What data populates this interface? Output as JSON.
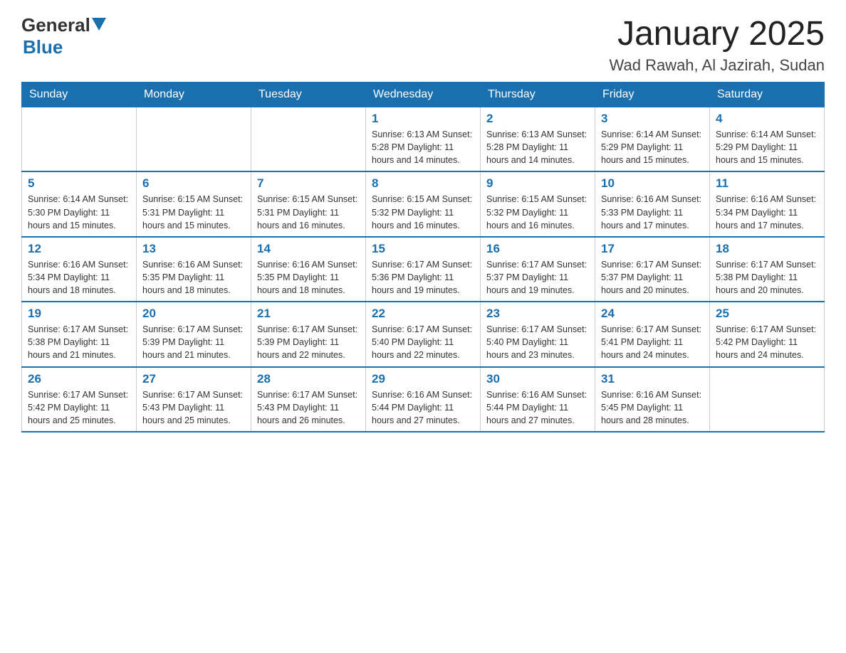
{
  "header": {
    "title": "January 2025",
    "subtitle": "Wad Rawah, Al Jazirah, Sudan"
  },
  "logo": {
    "general": "General",
    "blue": "Blue"
  },
  "days": [
    "Sunday",
    "Monday",
    "Tuesday",
    "Wednesday",
    "Thursday",
    "Friday",
    "Saturday"
  ],
  "weeks": [
    [
      {
        "day": "",
        "info": ""
      },
      {
        "day": "",
        "info": ""
      },
      {
        "day": "",
        "info": ""
      },
      {
        "day": "1",
        "info": "Sunrise: 6:13 AM\nSunset: 5:28 PM\nDaylight: 11 hours\nand 14 minutes."
      },
      {
        "day": "2",
        "info": "Sunrise: 6:13 AM\nSunset: 5:28 PM\nDaylight: 11 hours\nand 14 minutes."
      },
      {
        "day": "3",
        "info": "Sunrise: 6:14 AM\nSunset: 5:29 PM\nDaylight: 11 hours\nand 15 minutes."
      },
      {
        "day": "4",
        "info": "Sunrise: 6:14 AM\nSunset: 5:29 PM\nDaylight: 11 hours\nand 15 minutes."
      }
    ],
    [
      {
        "day": "5",
        "info": "Sunrise: 6:14 AM\nSunset: 5:30 PM\nDaylight: 11 hours\nand 15 minutes."
      },
      {
        "day": "6",
        "info": "Sunrise: 6:15 AM\nSunset: 5:31 PM\nDaylight: 11 hours\nand 15 minutes."
      },
      {
        "day": "7",
        "info": "Sunrise: 6:15 AM\nSunset: 5:31 PM\nDaylight: 11 hours\nand 16 minutes."
      },
      {
        "day": "8",
        "info": "Sunrise: 6:15 AM\nSunset: 5:32 PM\nDaylight: 11 hours\nand 16 minutes."
      },
      {
        "day": "9",
        "info": "Sunrise: 6:15 AM\nSunset: 5:32 PM\nDaylight: 11 hours\nand 16 minutes."
      },
      {
        "day": "10",
        "info": "Sunrise: 6:16 AM\nSunset: 5:33 PM\nDaylight: 11 hours\nand 17 minutes."
      },
      {
        "day": "11",
        "info": "Sunrise: 6:16 AM\nSunset: 5:34 PM\nDaylight: 11 hours\nand 17 minutes."
      }
    ],
    [
      {
        "day": "12",
        "info": "Sunrise: 6:16 AM\nSunset: 5:34 PM\nDaylight: 11 hours\nand 18 minutes."
      },
      {
        "day": "13",
        "info": "Sunrise: 6:16 AM\nSunset: 5:35 PM\nDaylight: 11 hours\nand 18 minutes."
      },
      {
        "day": "14",
        "info": "Sunrise: 6:16 AM\nSunset: 5:35 PM\nDaylight: 11 hours\nand 18 minutes."
      },
      {
        "day": "15",
        "info": "Sunrise: 6:17 AM\nSunset: 5:36 PM\nDaylight: 11 hours\nand 19 minutes."
      },
      {
        "day": "16",
        "info": "Sunrise: 6:17 AM\nSunset: 5:37 PM\nDaylight: 11 hours\nand 19 minutes."
      },
      {
        "day": "17",
        "info": "Sunrise: 6:17 AM\nSunset: 5:37 PM\nDaylight: 11 hours\nand 20 minutes."
      },
      {
        "day": "18",
        "info": "Sunrise: 6:17 AM\nSunset: 5:38 PM\nDaylight: 11 hours\nand 20 minutes."
      }
    ],
    [
      {
        "day": "19",
        "info": "Sunrise: 6:17 AM\nSunset: 5:38 PM\nDaylight: 11 hours\nand 21 minutes."
      },
      {
        "day": "20",
        "info": "Sunrise: 6:17 AM\nSunset: 5:39 PM\nDaylight: 11 hours\nand 21 minutes."
      },
      {
        "day": "21",
        "info": "Sunrise: 6:17 AM\nSunset: 5:39 PM\nDaylight: 11 hours\nand 22 minutes."
      },
      {
        "day": "22",
        "info": "Sunrise: 6:17 AM\nSunset: 5:40 PM\nDaylight: 11 hours\nand 22 minutes."
      },
      {
        "day": "23",
        "info": "Sunrise: 6:17 AM\nSunset: 5:40 PM\nDaylight: 11 hours\nand 23 minutes."
      },
      {
        "day": "24",
        "info": "Sunrise: 6:17 AM\nSunset: 5:41 PM\nDaylight: 11 hours\nand 24 minutes."
      },
      {
        "day": "25",
        "info": "Sunrise: 6:17 AM\nSunset: 5:42 PM\nDaylight: 11 hours\nand 24 minutes."
      }
    ],
    [
      {
        "day": "26",
        "info": "Sunrise: 6:17 AM\nSunset: 5:42 PM\nDaylight: 11 hours\nand 25 minutes."
      },
      {
        "day": "27",
        "info": "Sunrise: 6:17 AM\nSunset: 5:43 PM\nDaylight: 11 hours\nand 25 minutes."
      },
      {
        "day": "28",
        "info": "Sunrise: 6:17 AM\nSunset: 5:43 PM\nDaylight: 11 hours\nand 26 minutes."
      },
      {
        "day": "29",
        "info": "Sunrise: 6:16 AM\nSunset: 5:44 PM\nDaylight: 11 hours\nand 27 minutes."
      },
      {
        "day": "30",
        "info": "Sunrise: 6:16 AM\nSunset: 5:44 PM\nDaylight: 11 hours\nand 27 minutes."
      },
      {
        "day": "31",
        "info": "Sunrise: 6:16 AM\nSunset: 5:45 PM\nDaylight: 11 hours\nand 28 minutes."
      },
      {
        "day": "",
        "info": ""
      }
    ]
  ]
}
